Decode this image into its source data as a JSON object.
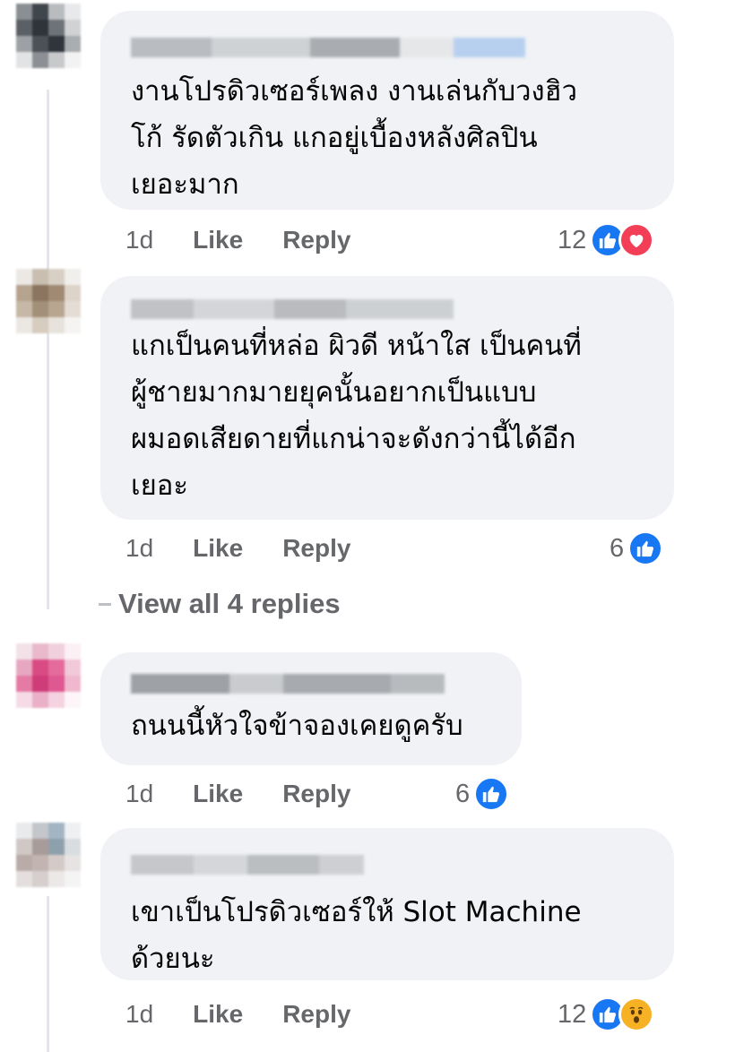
{
  "comments": [
    {
      "text": "งานโปรดิวเซอร์เพลง งานเล่นกับวงฮิว\nโก้ รัดตัวเกิน แกอยู่เบื้องหลังศิลปิน\nเยอะมาก",
      "time": "1d",
      "like_label": "Like",
      "reply_label": "Reply",
      "reaction_count": "12",
      "reactions": [
        "like-icon",
        "love-icon"
      ]
    },
    {
      "text": "แกเป็นคนที่หล่อ ผิวดี หน้าใส เป็นคนที่\nผู้ชายมากมายยุคนั้นอยากเป็นแบบ\nผมอดเสียดายที่แกน่าจะดังกว่านี้ได้อีก\nเยอะ",
      "time": "1d",
      "like_label": "Like",
      "reply_label": "Reply",
      "reaction_count": "6",
      "reactions": [
        "like-icon"
      ]
    },
    {
      "text": "ถนนนี้หัวใจข้าจองเคยดูครับ",
      "time": "1d",
      "like_label": "Like",
      "reply_label": "Reply",
      "reaction_count": "6",
      "reactions": [
        "like-icon"
      ]
    },
    {
      "text": "เขาเป็นโปรดิวเซอร์ให้ Slot Machine\nด้วยนะ",
      "time": "1d",
      "like_label": "Like",
      "reply_label": "Reply",
      "reaction_count": "12",
      "reactions": [
        "like-icon",
        "wow-icon"
      ]
    }
  ],
  "view_replies_label": "View all 4 replies",
  "colors": {
    "bubble": "#f0f2f5",
    "like": "#1877f2",
    "love": "#f33e58",
    "wow": "#f7b125",
    "meta_text": "#65676b"
  }
}
